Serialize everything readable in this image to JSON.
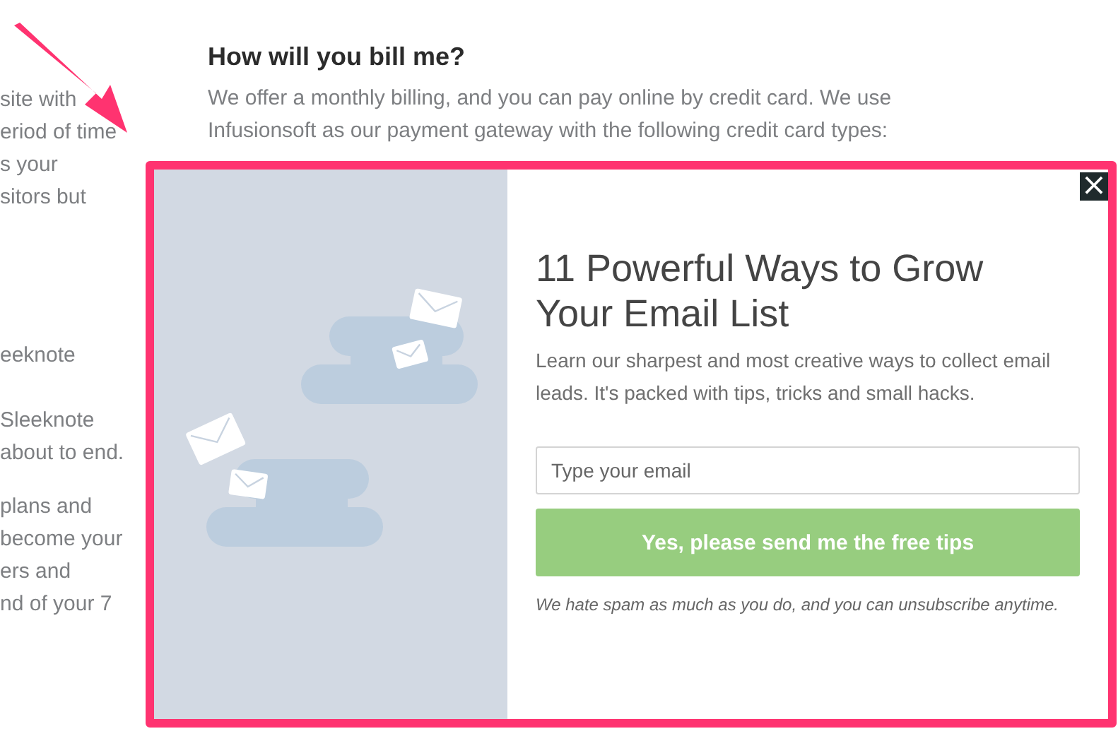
{
  "left_column": {
    "paragraphs": [
      {
        "lines": [
          [
            "site with"
          ],
          [
            "eriod of time"
          ],
          [
            "s your"
          ],
          [
            "sitors but"
          ]
        ]
      },
      {
        "lines": [
          [
            "eeknote"
          ]
        ]
      },
      {
        "lines": [
          [
            "Sleeknote"
          ],
          [
            "about to end."
          ]
        ]
      },
      {
        "lines": [
          [
            "plans and"
          ],
          [
            "become your"
          ],
          [
            "ers and"
          ],
          [
            "nd of your 7"
          ]
        ]
      }
    ]
  },
  "faq": {
    "heading": "How will you bill me?",
    "answer_lines": [
      "We offer a monthly billing, and you can pay online by credit card. We use",
      "Infusionsoft as our payment gateway with the following credit card types:"
    ]
  },
  "popup": {
    "close": "×",
    "title": "11 Powerful Ways to Grow Your Email List",
    "description": "Learn our sharpest and most creative ways to collect email leads. It's packed with tips, tricks and small hacks.",
    "email": {
      "placeholder": "Type your email"
    },
    "submit": "Yes, please send me the free tips",
    "note": "We hate spam as much as you do, and you can unsubscribe anytime."
  }
}
